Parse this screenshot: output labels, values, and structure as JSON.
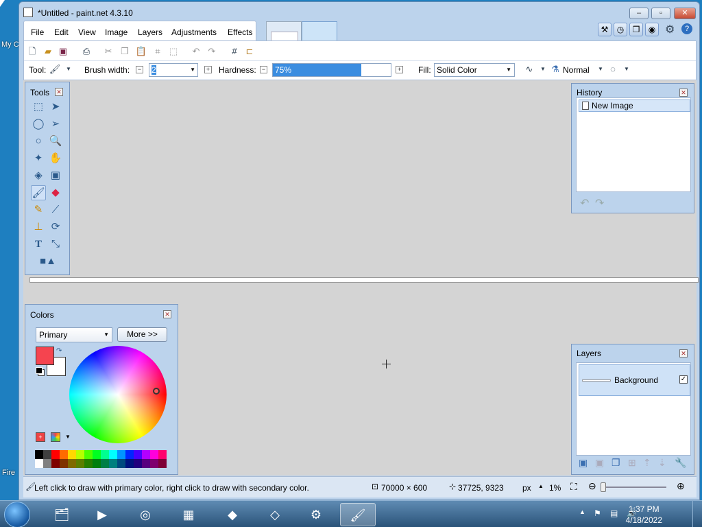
{
  "desktop": {
    "icon_label_1": "My C",
    "icon_label_2": "Fire"
  },
  "window": {
    "title": "*Untitled - paint.net 4.3.10"
  },
  "menu": [
    "File",
    "Edit",
    "View",
    "Image",
    "Layers",
    "Adjustments",
    "Effects"
  ],
  "toolbar": {
    "tool_label": "Tool:",
    "brush_width_label": "Brush width:",
    "brush_width_value": "2",
    "hardness_label": "Hardness:",
    "hardness_value": "75%",
    "hardness_level": 0.75,
    "fill_label": "Fill:",
    "fill_value": "Solid Color",
    "blend_mode": "Normal"
  },
  "tools_panel": {
    "title": "Tools"
  },
  "history_panel": {
    "title": "History",
    "items": [
      "New Image"
    ]
  },
  "colors_panel": {
    "title": "Colors",
    "mode": "Primary",
    "more_button": "More >>",
    "primary_color": "#f5444f",
    "secondary_color": "#ffffff"
  },
  "layers_panel": {
    "title": "Layers",
    "layers": [
      {
        "name": "Background",
        "visible": true
      }
    ]
  },
  "status": {
    "hint": "Left click to draw with primary color, right click to draw with secondary color.",
    "image_size": "70000 × 600",
    "cursor_position": "37725, 9323",
    "units": "px",
    "zoom": "1%"
  },
  "taskbar": {
    "time": "1:37 PM",
    "date": "4/18/2022"
  },
  "palette_colors": [
    "#000000",
    "#404040",
    "#ff0000",
    "#ff6a00",
    "#ffd800",
    "#b6ff00",
    "#4cff00",
    "#00ff21",
    "#00ff90",
    "#00ffff",
    "#0094ff",
    "#0026ff",
    "#4800ff",
    "#b200ff",
    "#ff00dc",
    "#ff006e",
    "#ffffff",
    "#808080",
    "#7f0000",
    "#7f3300",
    "#7f6a00",
    "#5b7f00",
    "#267f00",
    "#007f0e",
    "#007f46",
    "#007f7f",
    "#004a7f",
    "#00137f",
    "#21007f",
    "#57007f",
    "#7f006e",
    "#7f0037"
  ]
}
